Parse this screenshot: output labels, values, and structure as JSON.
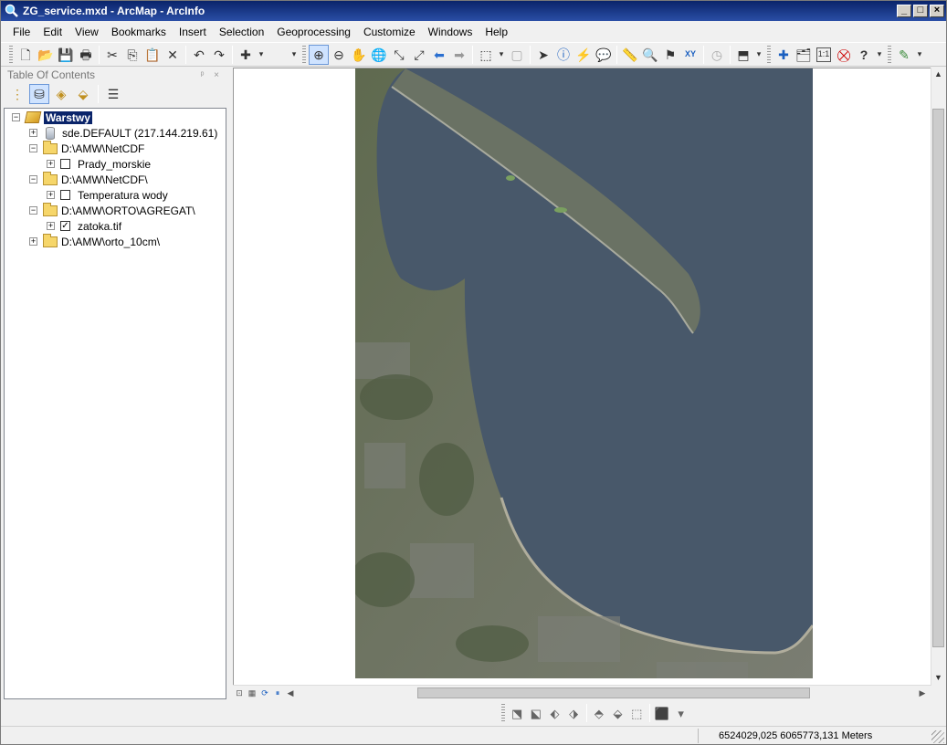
{
  "window": {
    "title": "ZG_service.mxd - ArcMap - ArcInfo",
    "min_glyph": "_",
    "max_glyph": "□",
    "close_glyph": "×"
  },
  "menubar": {
    "items": [
      "File",
      "Edit",
      "View",
      "Bookmarks",
      "Insert",
      "Selection",
      "Geoprocessing",
      "Customize",
      "Windows",
      "Help"
    ]
  },
  "toc": {
    "title": "Table Of Contents",
    "close_glyph": "ᵖ ×",
    "items": [
      {
        "label": "Warstwy",
        "expander": "−",
        "type": "root"
      },
      {
        "label": "sde.DEFAULT (217.144.219.61)",
        "expander": "+",
        "type": "db"
      },
      {
        "label": "D:\\AMW\\NetCDF",
        "expander": "−",
        "type": "folder"
      },
      {
        "label": "Prady_morskie",
        "expander": "+",
        "type": "layer",
        "checked": false
      },
      {
        "label": "D:\\AMW\\NetCDF\\",
        "expander": "−",
        "type": "folder"
      },
      {
        "label": "Temperatura wody",
        "expander": "+",
        "type": "layer",
        "checked": false
      },
      {
        "label": "D:\\AMW\\ORTO\\AGREGAT\\",
        "expander": "−",
        "type": "folder"
      },
      {
        "label": "zatoka.tif",
        "expander": "+",
        "type": "layer",
        "checked": true,
        "check_glyph": "✓"
      },
      {
        "label": "D:\\AMW\\orto_10cm\\",
        "expander": "+",
        "type": "folder"
      }
    ]
  },
  "icons": {
    "new": "🗋",
    "open": "📂",
    "save": "💾",
    "print": "🖶",
    "cut": "✂",
    "copy": "⎘",
    "paste": "📋",
    "delete": "✕",
    "undo": "↶",
    "redo": "↷",
    "add_data": "✚",
    "dropdown": "▾",
    "zoom_in": "⊕",
    "zoom_out": "⊖",
    "pan": "✋",
    "full_extent": "🌐",
    "fixed_zoom_in": "⤡",
    "fixed_zoom_out": "⤢",
    "back": "⬅",
    "forward": "➡",
    "select_features": "⬚",
    "clear_selection": "▢",
    "select_elements": "➤",
    "identify": "ⓘ",
    "hyperlink": "⚡",
    "html_popup": "💬",
    "measure": "📏",
    "find": "🔍",
    "route": "⚑",
    "goto_xy": "XY",
    "time_slider": "◷",
    "viewer": "⬒",
    "add_layer": "✚",
    "catalog": "🗂",
    "scale": "1:1",
    "stop": "⛒",
    "help": "?",
    "editor": "✎",
    "collapse": "⊟",
    "expand": "⊞",
    "list_drawing": "⋮",
    "list_source": "⛁",
    "list_visibility": "◈",
    "list_selection": "⬙",
    "options": "☰",
    "layout_view": "⊡",
    "data_view": "▦",
    "refresh": "⟳",
    "pause": "⏸",
    "scroll_up": "▲",
    "scroll_down": "▼",
    "scroll_left": "◀",
    "scroll_right": "▶",
    "b1": "⬔",
    "b2": "⬕",
    "b3": "⬖",
    "b4": "⬗",
    "b5": "⬘",
    "b6": "⬙",
    "b7": "⬚",
    "b8": "⬛"
  },
  "status": {
    "coordinates": "6524029,025  6065773,131 Meters"
  },
  "colors": {
    "title_bar": "#0a246a",
    "selection": "#0a246a",
    "water": "#48586a",
    "land": "#6d7560"
  }
}
